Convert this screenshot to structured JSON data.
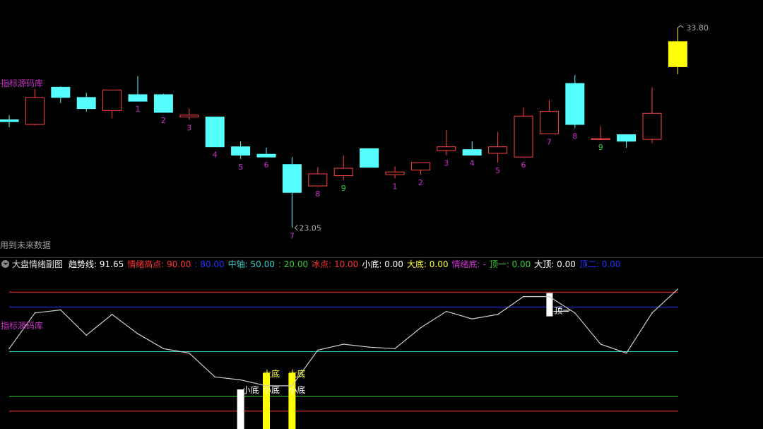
{
  "labels": {
    "source_top": "指标源码库",
    "source_bottom": "指标源码库",
    "future_data": "用到未来数据",
    "indicator_name": "大盘情绪副图"
  },
  "legend": [
    {
      "label": "趋势线",
      "value": "91.65",
      "color": "#ffffff"
    },
    {
      "label": "情绪高点",
      "value": "90.00",
      "color": "#ff3333"
    },
    {
      "label": "",
      "value": "80.00",
      "color": "#2233ff"
    },
    {
      "label": "中轴",
      "value": "50.00",
      "color": "#33cccc"
    },
    {
      "label": "",
      "value": "20.00",
      "color": "#33cc33"
    },
    {
      "label": "冰点",
      "value": "10.00",
      "color": "#ff3333"
    },
    {
      "label": "小底",
      "value": "0.00",
      "color": "#ffffff"
    },
    {
      "label": "大底",
      "value": "0.00",
      "color": "#ffff33"
    },
    {
      "label": "情绪底",
      "value": "-",
      "color": "#cc33cc"
    },
    {
      "label": "顶一",
      "value": "0.00",
      "color": "#33cc33"
    },
    {
      "label": "大顶",
      "value": "0.00",
      "color": "#ffffff"
    },
    {
      "label": "顶二",
      "value": "0.00",
      "color": "#2233ff"
    }
  ],
  "colors": {
    "up_candle": "#ff4444",
    "down_candle": "#55ffff",
    "limit_candle": "#ffff00",
    "count_label": "#cc33cc",
    "nine_label": "#33cc33",
    "trend_line": "#cccccc"
  },
  "chart_data": [
    {
      "type": "candlestick",
      "title": "",
      "ylim": [
        22.0,
        34.6
      ],
      "annotations": [
        {
          "text": "33.80",
          "index": 26,
          "value": 33.8,
          "kind": "high"
        },
        {
          "text": "23.05",
          "index": 11,
          "value": 23.05,
          "kind": "low"
        }
      ],
      "candles": [
        {
          "o": 28.85,
          "c": 28.75,
          "h": 29.1,
          "l": 28.45,
          "label": ""
        },
        {
          "o": 28.6,
          "c": 30.05,
          "h": 30.5,
          "l": 28.55,
          "label": ""
        },
        {
          "o": 30.6,
          "c": 30.05,
          "h": 30.65,
          "l": 29.75,
          "label": ""
        },
        {
          "o": 30.05,
          "c": 29.45,
          "h": 30.3,
          "l": 29.3,
          "label": ""
        },
        {
          "o": 29.35,
          "c": 30.45,
          "h": 30.45,
          "l": 28.95,
          "label": ""
        },
        {
          "o": 30.2,
          "c": 29.85,
          "h": 31.2,
          "l": 29.85,
          "label": "1"
        },
        {
          "o": 30.2,
          "c": 29.25,
          "h": 30.25,
          "l": 29.25,
          "label": "2"
        },
        {
          "o": 29.0,
          "c": 29.1,
          "h": 29.45,
          "l": 28.85,
          "label": "3"
        },
        {
          "o": 29.0,
          "c": 27.4,
          "h": 29.0,
          "l": 27.4,
          "label": "4"
        },
        {
          "o": 27.4,
          "c": 26.95,
          "h": 27.7,
          "l": 26.75,
          "label": "5"
        },
        {
          "o": 27.0,
          "c": 26.85,
          "h": 27.35,
          "l": 26.85,
          "label": "6"
        },
        {
          "o": 26.45,
          "c": 24.95,
          "h": 26.85,
          "l": 23.05,
          "label": "7"
        },
        {
          "o": 25.3,
          "c": 25.95,
          "h": 26.3,
          "l": 25.3,
          "label": "8"
        },
        {
          "o": 25.85,
          "c": 26.25,
          "h": 26.95,
          "l": 25.6,
          "label": "9"
        },
        {
          "o": 27.3,
          "c": 26.3,
          "h": 27.3,
          "l": 26.3,
          "label": ""
        },
        {
          "o": 25.9,
          "c": 26.05,
          "h": 26.35,
          "l": 25.7,
          "label": "1"
        },
        {
          "o": 26.15,
          "c": 26.55,
          "h": 26.55,
          "l": 25.9,
          "label": "2"
        },
        {
          "o": 27.2,
          "c": 27.4,
          "h": 28.3,
          "l": 26.95,
          "label": "3"
        },
        {
          "o": 27.25,
          "c": 26.95,
          "h": 27.7,
          "l": 26.95,
          "label": "4"
        },
        {
          "o": 27.05,
          "c": 27.4,
          "h": 28.2,
          "l": 26.55,
          "label": "5"
        },
        {
          "o": 26.85,
          "c": 29.05,
          "h": 29.5,
          "l": 26.85,
          "label": "6"
        },
        {
          "o": 28.1,
          "c": 29.3,
          "h": 29.9,
          "l": 28.1,
          "label": "7"
        },
        {
          "o": 30.8,
          "c": 28.6,
          "h": 31.25,
          "l": 28.4,
          "label": "8"
        },
        {
          "o": 27.85,
          "c": 27.85,
          "h": 28.5,
          "l": 27.8,
          "label": "9"
        },
        {
          "o": 28.05,
          "c": 27.7,
          "h": 28.05,
          "l": 27.35,
          "label": ""
        },
        {
          "o": 27.8,
          "c": 29.2,
          "h": 30.6,
          "l": 27.6,
          "label": ""
        },
        {
          "o": 31.7,
          "c": 33.05,
          "h": 33.8,
          "l": 31.3,
          "label": "",
          "limit": true
        }
      ]
    },
    {
      "type": "line",
      "title": "大盘情绪副图",
      "ylim": [
        -2,
        102
      ],
      "series": [
        {
          "name": "趋势线",
          "values": [
            52,
            76,
            78,
            61,
            75,
            62,
            52,
            49,
            33,
            31,
            27,
            27,
            51,
            55,
            53,
            52,
            66,
            77,
            72,
            75,
            87,
            87,
            76,
            55,
            49,
            76,
            92
          ]
        }
      ],
      "lines": [
        {
          "name": "情绪高点",
          "value": 90,
          "color": "#ff3333"
        },
        {
          "name": "",
          "value": 80,
          "color": "#2233ff"
        },
        {
          "name": "中轴",
          "value": 50,
          "color": "#33cccc"
        },
        {
          "name": "",
          "value": 20,
          "color": "#33cc33"
        },
        {
          "name": "冰点",
          "value": 10,
          "color": "#ff3333"
        }
      ],
      "signals": [
        {
          "index": 9,
          "kind": "xiaodi",
          "texts": [
            "小底"
          ],
          "color": "#ffffff"
        },
        {
          "index": 10,
          "kind": "dadi",
          "texts": [
            "大底",
            "小底"
          ],
          "color": "#ffff00"
        },
        {
          "index": 11,
          "kind": "dadi",
          "texts": [
            "大底",
            "小底"
          ],
          "color": "#ffff00"
        },
        {
          "index": 21,
          "kind": "top",
          "texts": [
            "顶一"
          ],
          "color": "#ffffff"
        }
      ]
    }
  ]
}
